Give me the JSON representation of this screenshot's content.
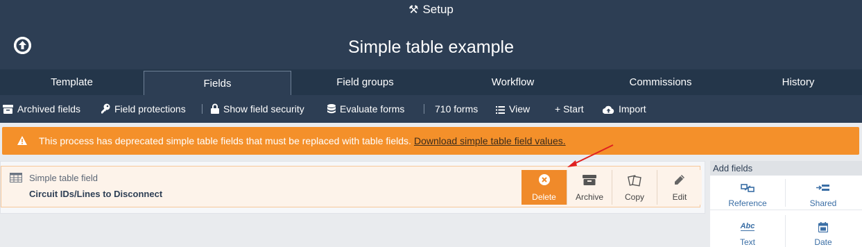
{
  "header": {
    "setup_label": "Setup",
    "page_title": "Simple table example"
  },
  "tabs": [
    "Template",
    "Fields",
    "Field groups",
    "Workflow",
    "Commissions",
    "History"
  ],
  "toolbar": {
    "archived_fields": "Archived fields",
    "field_protections": "Field protections",
    "show_field_security": "Show field security",
    "evaluate_forms": "Evaluate forms",
    "forms_count": "710 forms",
    "view": "View",
    "start": "+ Start",
    "import": "Import"
  },
  "alert": {
    "message": "This process has deprecated simple table fields that must be replaced with table fields.",
    "link": "Download simple table field values."
  },
  "field": {
    "type_label": "Simple table field",
    "name": "Circuit IDs/Lines to Disconnect",
    "actions": {
      "delete": "Delete",
      "archive": "Archive",
      "copy": "Copy",
      "edit": "Edit"
    }
  },
  "add_fields": {
    "title": "Add fields",
    "items": [
      "Reference",
      "Shared",
      "Text",
      "Date"
    ]
  },
  "colors": {
    "header_bg": "#2d3e54",
    "tabs_bg": "#24364a",
    "alert_bg": "#f4902a",
    "delete_bg": "#f08a2a",
    "arrow": "#e02020"
  }
}
